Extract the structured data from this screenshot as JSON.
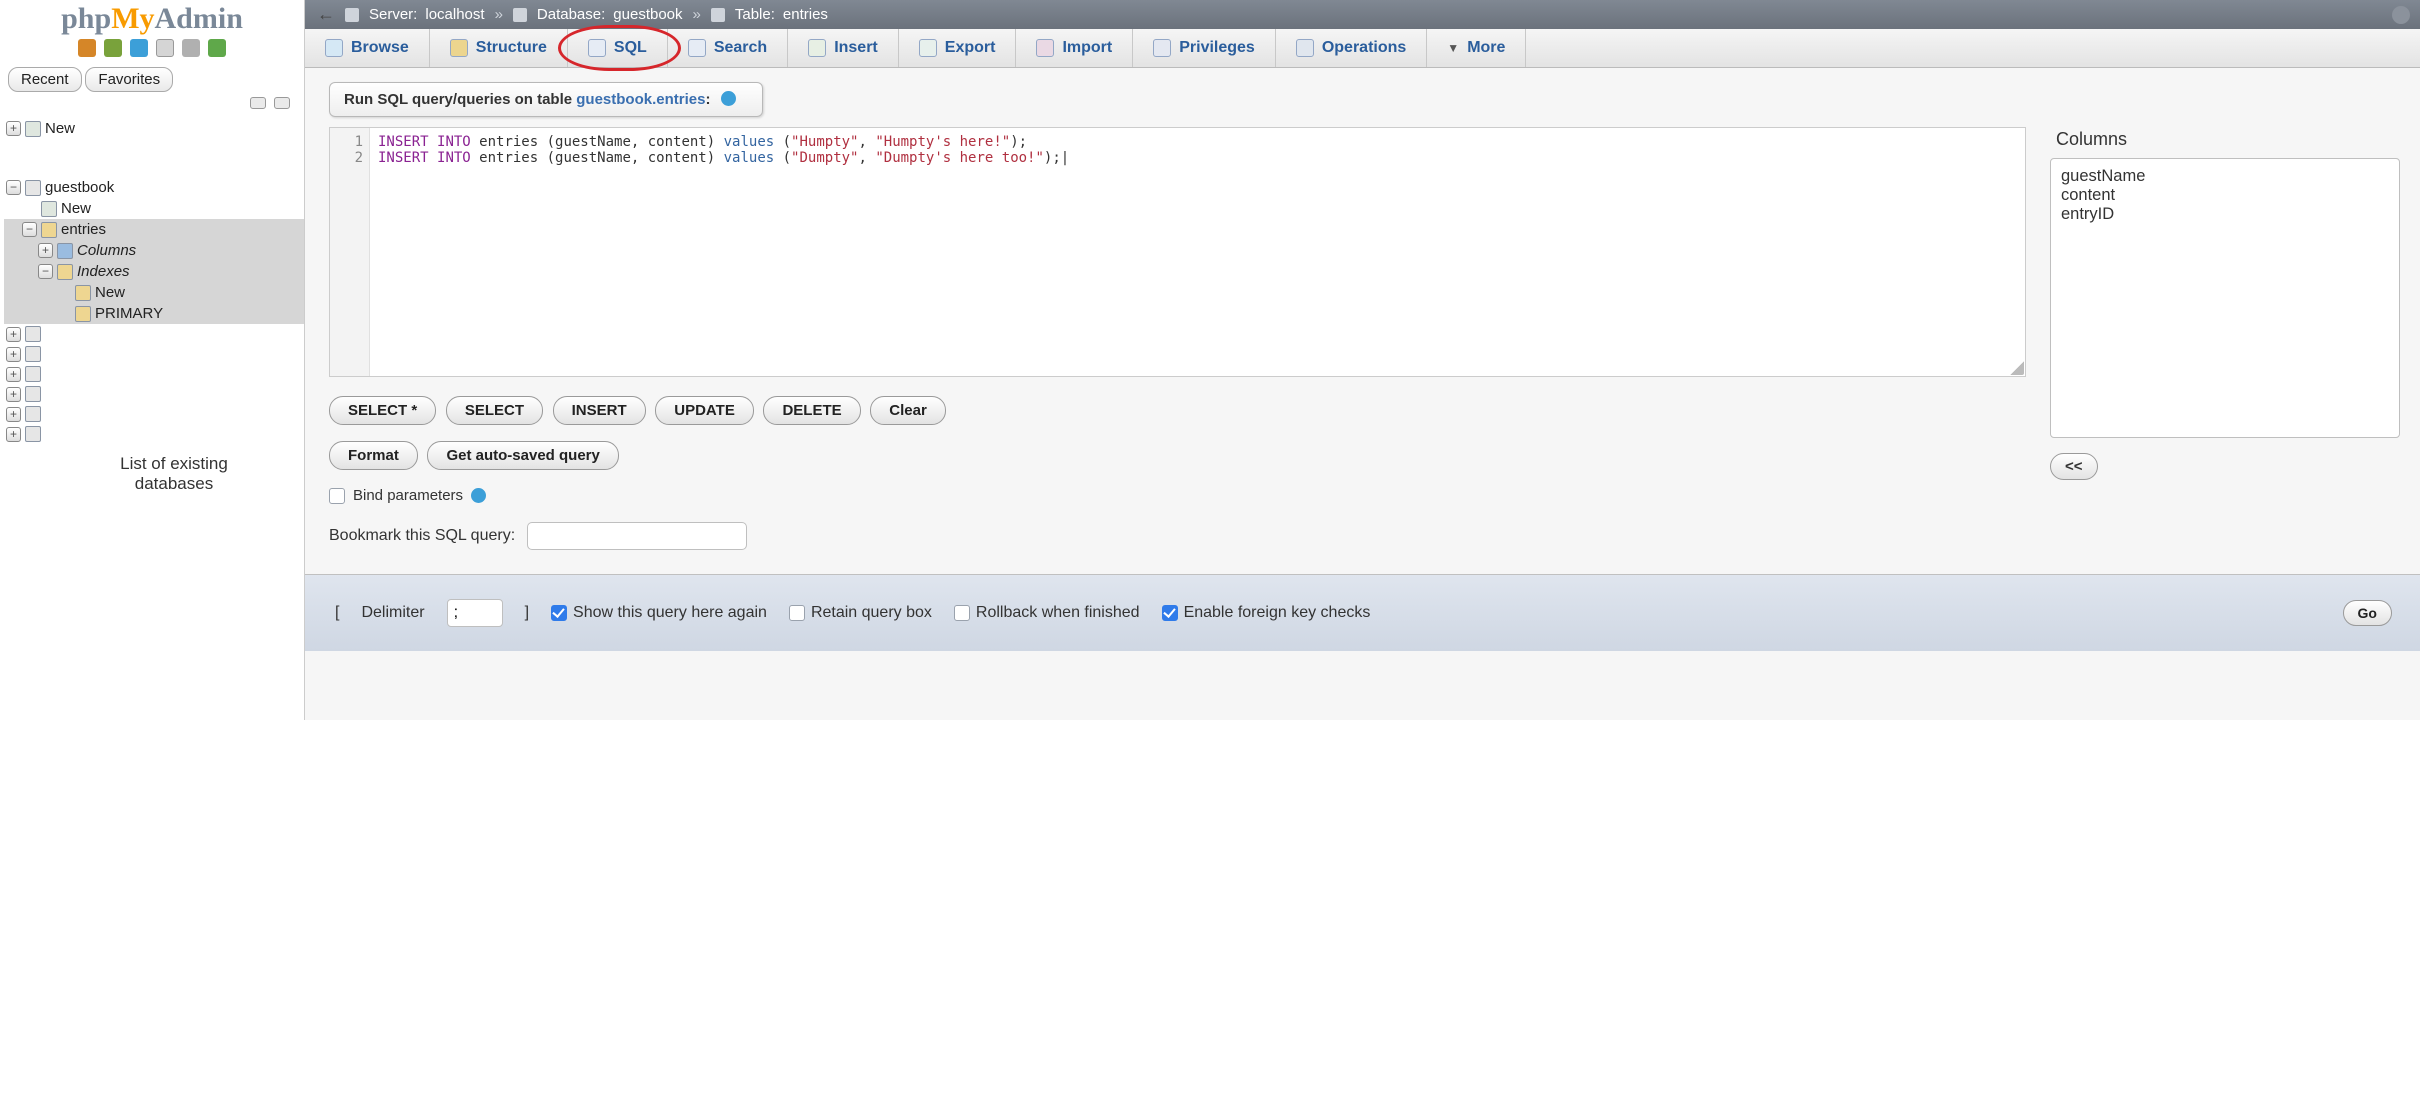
{
  "logo": {
    "part1": "php",
    "part2": "My",
    "part3": "Admin"
  },
  "pills": {
    "recent": "Recent",
    "favorites": "Favorites"
  },
  "tree": {
    "new": "New",
    "db": "guestbook",
    "db_new": "New",
    "table": "entries",
    "columns": "Columns",
    "indexes": "Indexes",
    "idx_new": "New",
    "idx_primary": "PRIMARY"
  },
  "note": {
    "line1": "List of existing",
    "line2": "databases"
  },
  "breadcrumb": {
    "server_lbl": "Server:",
    "server_val": "localhost",
    "db_lbl": "Database:",
    "db_val": "guestbook",
    "tbl_lbl": "Table:",
    "tbl_val": "entries"
  },
  "tabs": {
    "browse": "Browse",
    "structure": "Structure",
    "sql": "SQL",
    "search": "Search",
    "insert": "Insert",
    "export": "Export",
    "import": "Import",
    "privileges": "Privileges",
    "operations": "Operations",
    "more": "More"
  },
  "panel": {
    "head_pre": "Run SQL query/queries on table ",
    "head_link": "guestbook.entries",
    "head_post": ":"
  },
  "sql": {
    "lines": [
      "1",
      "2"
    ],
    "code_html": "<span class='kw'>INSERT</span> <span class='kw'>INTO</span> entries (guestName, content) <span class='fn'>values</span> (<span class='str'>\"Humpty\"</span>, <span class='str'>\"Humpty's here!\"</span>);\n<span class='kw'>INSERT</span> <span class='kw'>INTO</span> entries (guestName, content) <span class='fn'>values</span> (<span class='str'>\"Dumpty\"</span>, <span class='str'>\"Dumpty's here too!\"</span>);|"
  },
  "columns": {
    "label": "Columns",
    "items": [
      "guestName",
      "content",
      "entryID"
    ],
    "insert_btn": "<<"
  },
  "buttons": {
    "select_star": "SELECT *",
    "select": "SELECT",
    "insert": "INSERT",
    "update": "UPDATE",
    "delete": "DELETE",
    "clear": "Clear",
    "format": "Format",
    "autosaved": "Get auto-saved query"
  },
  "bind_params": "Bind parameters",
  "bookmark": {
    "label": "Bookmark this SQL query:",
    "value": ""
  },
  "footer": {
    "delim_label": "Delimiter",
    "delim_value": ";",
    "bracket_open": "[",
    "bracket_close": "]",
    "show_again": "Show this query here again",
    "retain": "Retain query box",
    "rollback": "Rollback when finished",
    "fk": "Enable foreign key checks",
    "go": "Go"
  }
}
